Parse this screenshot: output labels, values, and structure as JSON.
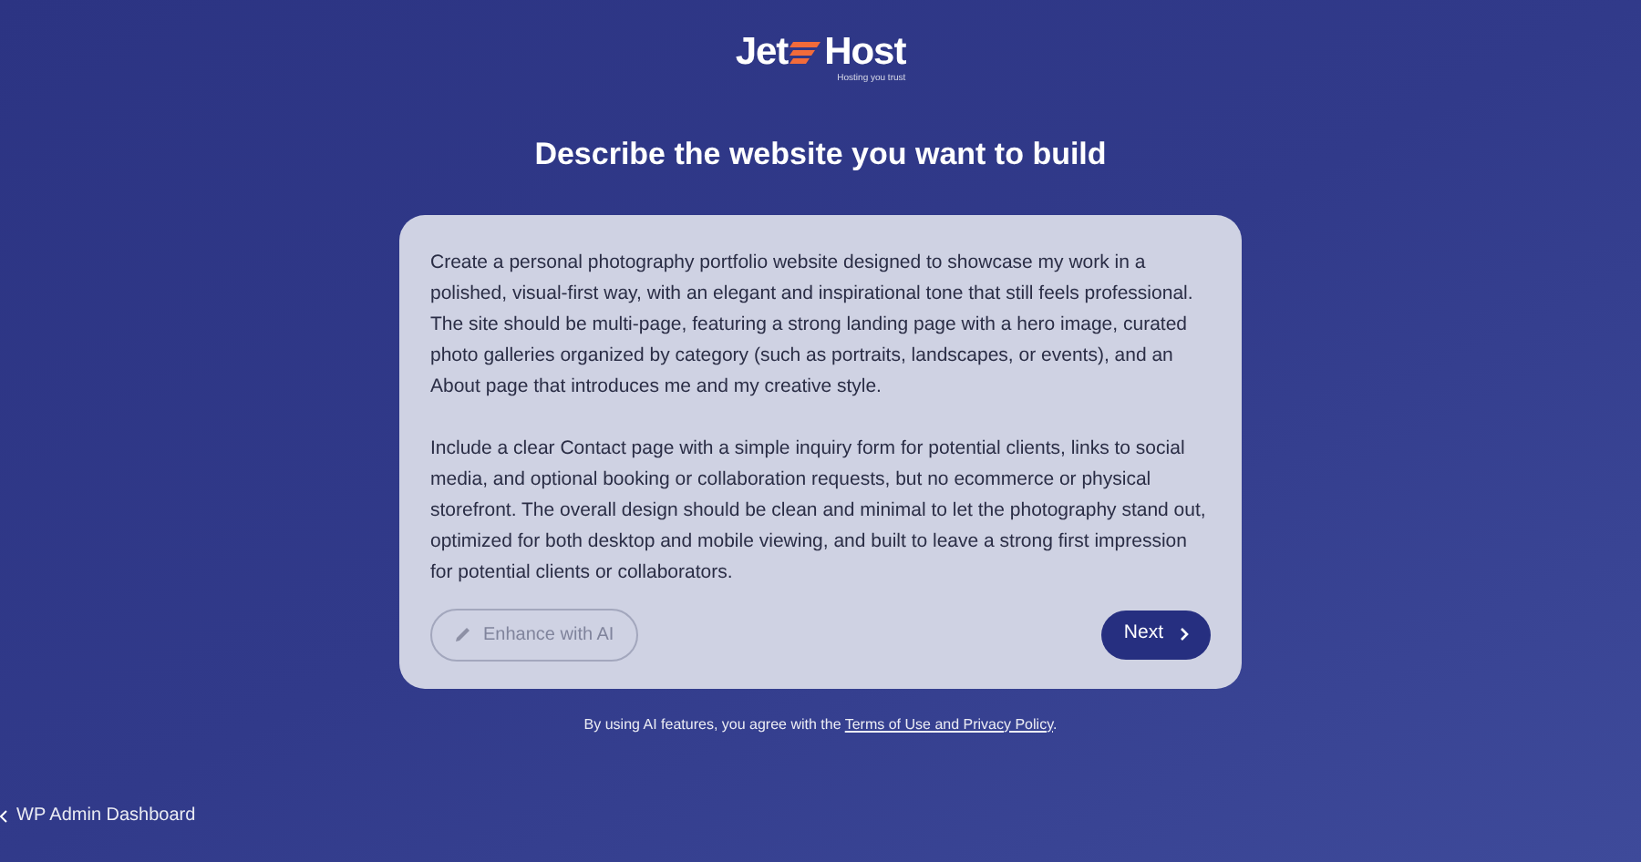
{
  "logo": {
    "word_left": "Jet",
    "word_right": "Host",
    "tagline": "Hosting you trust"
  },
  "heading": "Describe the website you want to build",
  "prompt": {
    "paragraphs": [
      "Create a personal photography portfolio website designed to showcase my work in a polished, visual-first way, with an elegant and inspirational tone that still feels professional. The site should be multi-page, featuring a strong landing page with a hero image, curated photo galleries organized by category (such as portraits, landscapes, or events), and an About page that introduces me and my creative style.",
      "Include a clear Contact page with a simple inquiry form for potential clients, links to social media, and optional booking or collaboration requests, but no ecommerce or physical storefront. The overall design should be clean and minimal to let the photography stand out, optimized for both desktop and mobile viewing, and built to leave a strong first impression for potential clients or collaborators."
    ]
  },
  "buttons": [
    {
      "label": "Enhance with AI",
      "kind": "enhance",
      "disabled": true
    },
    {
      "label": "Next",
      "kind": "next",
      "disabled": false
    }
  ],
  "consent": {
    "text": "By using AI features, you agree with the",
    "link": "Terms of Use and Privacy Policy",
    "end": "."
  },
  "back_link": "WP Admin Dashboard"
}
